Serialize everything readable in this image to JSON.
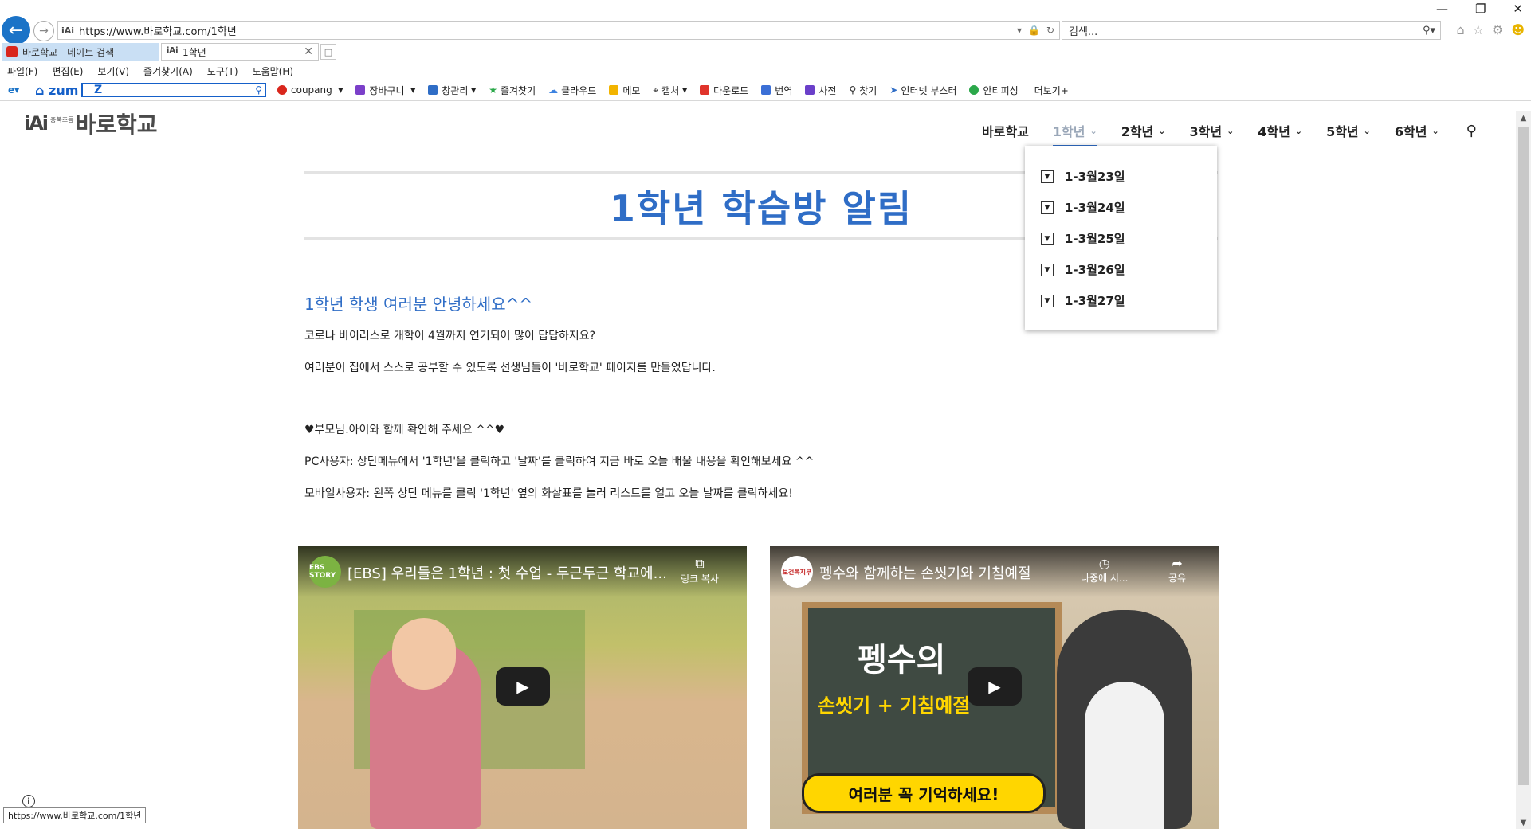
{
  "browser": {
    "url": "https://www.바로학교.com/1학년",
    "search_placeholder": "검색...",
    "tabs": [
      {
        "label": "바로학교 - 네이트 검색"
      },
      {
        "label": "1학년"
      }
    ],
    "menu": [
      "파일(F)",
      "편집(E)",
      "보기(V)",
      "즐겨찾기(A)",
      "도구(T)",
      "도움말(H)"
    ],
    "toolbar": {
      "zum_label": "zum",
      "items": [
        "coupang",
        "장바구니",
        "창관리",
        "즐겨찾기",
        "클라우드",
        "메모",
        "캡처",
        "다운로드",
        "번역",
        "사전",
        "찾기",
        "인터넷 부스터",
        "안티피싱"
      ],
      "more": "더보기+"
    },
    "status_url": "https://www.바로학교.com/1학년"
  },
  "site": {
    "logo_small": "충북초등",
    "logo_name": "바로학교",
    "nav": [
      {
        "label": "바로학교"
      },
      {
        "label": "1학년"
      },
      {
        "label": "2학년"
      },
      {
        "label": "3학년"
      },
      {
        "label": "4학년"
      },
      {
        "label": "5학년"
      },
      {
        "label": "6학년"
      }
    ],
    "dropdown": [
      "1-3월23일",
      "1-3월24일",
      "1-3월25일",
      "1-3월26일",
      "1-3월27일"
    ]
  },
  "page": {
    "title_num": "1",
    "title_rest": "학년 학습방 알림",
    "greeting": "1학년 학생 여러분 안녕하세요^^",
    "paragraphs": [
      "코로나 바이러스로 개학이 4월까지 연기되어 많이 답답하지요?",
      "여러분이 집에서 스스로 공부할 수 있도록 선생님들이 '바로학교' 페이지를 만들었답니다.",
      "♥부모님.아이와 함께 확인해 주세요 ^^♥",
      "PC사용자: 상단메뉴에서 '1학년'을 클릭하고 '날짜'를 클릭하여 지금 바로 오늘 배울 내용을 확인해보세요 ^^",
      "모바일사용자: 왼쪽 상단 메뉴를 클릭 '1학년' 옆의 화살표를 눌러 리스트를 열고 오늘 날짜를 클릭하세요!"
    ]
  },
  "videos": [
    {
      "channel": "EBS STORY",
      "title": "[EBS] 우리들은 1학년 : 첫 수업 - 두근두근 학교에...",
      "action": "링크 복사"
    },
    {
      "channel": "보건복지부",
      "title": "펭수와 함께하는 손씻기와 기침예절",
      "action_1": "나중에 시...",
      "action_2": "공유",
      "board_line_1": "펭수의",
      "board_line_2": "손씻기 + 기침예절",
      "banner": "여러분 꼭 기억하세요!"
    }
  ]
}
